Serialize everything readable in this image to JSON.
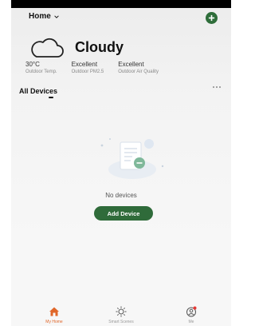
{
  "header": {
    "home_label": "Home"
  },
  "weather": {
    "condition": "Cloudy",
    "stats": [
      {
        "value": "30°C",
        "label": "Outdoor Temp."
      },
      {
        "value": "Excellent",
        "label": "Outdoor PM2.5"
      },
      {
        "value": "Excellent",
        "label": "Outdoor Air Quality"
      }
    ]
  },
  "section": {
    "title": "All Devices"
  },
  "empty_state": {
    "message": "No devices",
    "button_label": "Add Device"
  },
  "bottom_nav": [
    {
      "label": "My Home",
      "icon": "home-icon",
      "active": true
    },
    {
      "label": "Smart Scenes",
      "icon": "sun-icon",
      "active": false
    },
    {
      "label": "Me",
      "icon": "profile-icon",
      "active": false
    }
  ],
  "colors": {
    "accent_green": "#2e6d3a",
    "active_tab": "#e0672a",
    "badge_red": "#e53935"
  }
}
